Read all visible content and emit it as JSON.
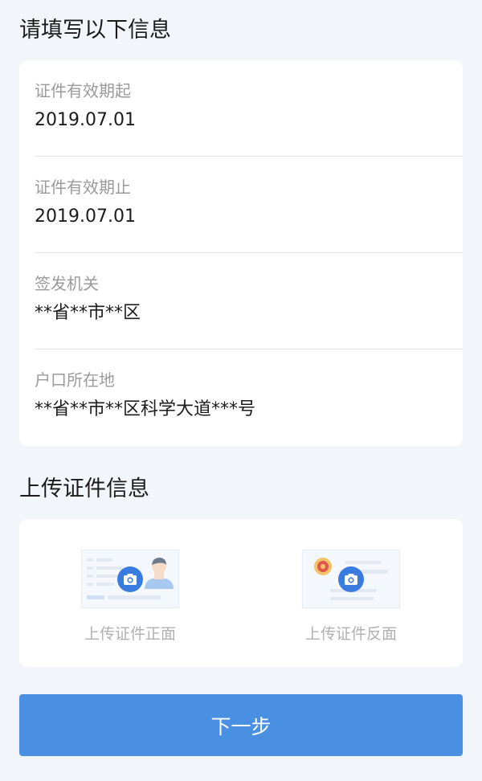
{
  "form": {
    "title": "请填写以下信息",
    "fields": [
      {
        "label": "证件有效期起",
        "value": "2019.07.01"
      },
      {
        "label": "证件有效期止",
        "value": "2019.07.01"
      },
      {
        "label": "签发机关",
        "value": "**省**市**区"
      },
      {
        "label": "户口所在地",
        "value": "**省**市**区科学大道***号"
      }
    ]
  },
  "upload": {
    "title": "上传证件信息",
    "front_label": "上传证件正面",
    "back_label": "上传证件反面"
  },
  "next_button_label": "下一步",
  "colors": {
    "accent": "#4a90e2",
    "background": "#f2f5f9",
    "card": "#ffffff",
    "label": "#9a9a9a",
    "value": "#1c1c1c"
  },
  "icons": [
    "camera-icon",
    "avatar-placeholder-icon",
    "national-emblem-icon"
  ]
}
